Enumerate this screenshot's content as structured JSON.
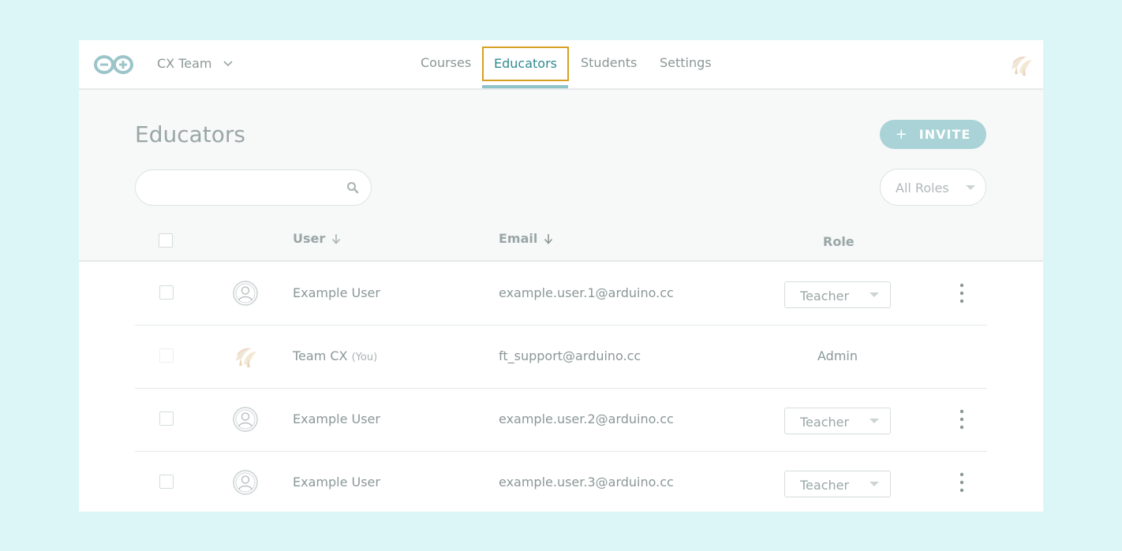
{
  "header": {
    "team_name": "CX Team",
    "nav": [
      {
        "label": "Courses"
      },
      {
        "label": "Educators",
        "active": true
      },
      {
        "label": "Students"
      },
      {
        "label": "Settings"
      }
    ]
  },
  "page": {
    "title": "Educators",
    "invite_label": "INVITE",
    "search_placeholder": "",
    "roles_filter": "All Roles"
  },
  "table": {
    "columns": {
      "user": "User",
      "email": "Email",
      "role": "Role"
    },
    "rows": [
      {
        "name": "Example User",
        "you": "",
        "email": "example.user.1@arduino.cc",
        "role": "Teacher",
        "editable": true
      },
      {
        "name": "Team CX",
        "you": "(You)",
        "email": "ft_support@arduino.cc",
        "role": "Admin",
        "editable": false
      },
      {
        "name": "Example User",
        "you": "",
        "email": "example.user.2@arduino.cc",
        "role": "Teacher",
        "editable": true
      },
      {
        "name": "Example User",
        "you": "",
        "email": "example.user.3@arduino.cc",
        "role": "Teacher",
        "editable": true
      }
    ]
  },
  "colors": {
    "accent": "#2f8a8e",
    "invite_bg": "#a9d3d6",
    "focus_outline": "#d6a022"
  },
  "icons": [
    "arduino-logo-icon",
    "chevron-down-icon",
    "search-icon",
    "sort-down-icon",
    "user-avatar-icon",
    "kebab-menu-icon"
  ]
}
